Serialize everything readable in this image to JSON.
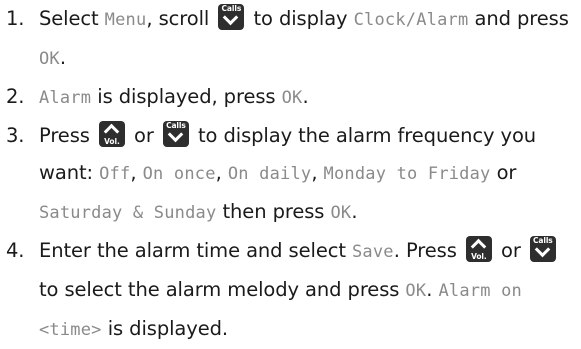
{
  "keys": {
    "calls": {
      "label": "Calls",
      "icon": "chevron-down-icon"
    },
    "vol": {
      "label": "Vol.",
      "icon": "chevron-up-icon"
    }
  },
  "steps": [
    {
      "number": "1.",
      "t1": "Select ",
      "lcd_menu": "Menu",
      "t2": ", scroll",
      "t3": "to display ",
      "lcd_clock": "Clock/Alarm",
      "t4": " and press ",
      "lcd_ok": "OK",
      "t5": "."
    },
    {
      "number": "2.",
      "lcd_alarm": "Alarm",
      "t1": " is displayed, press ",
      "lcd_ok": "OK",
      "t2": "."
    },
    {
      "number": "3.",
      "t1": "Press",
      "t2": "or",
      "t3": "to display the alarm frequency you want: ",
      "lcd_off": "Off",
      "sep1": ", ",
      "lcd_once": "On once",
      "sep2": ", ",
      "lcd_daily": "On daily",
      "sep3": ", ",
      "lcd_weekdays": "Monday to Friday",
      "t4": " or ",
      "lcd_weekend": "Saturday & Sunday",
      "t5": " then press ",
      "lcd_ok": "OK",
      "t6": "."
    },
    {
      "number": "4.",
      "t1": "Enter the alarm time and select ",
      "lcd_save": "Save",
      "t2": ". Press ",
      "t3": "or",
      "t4": "to select the alarm melody and press ",
      "lcd_ok": "OK",
      "t5": ". ",
      "lcd_alarm_on": "Alarm on <time>",
      "t6": " is displayed."
    }
  ]
}
